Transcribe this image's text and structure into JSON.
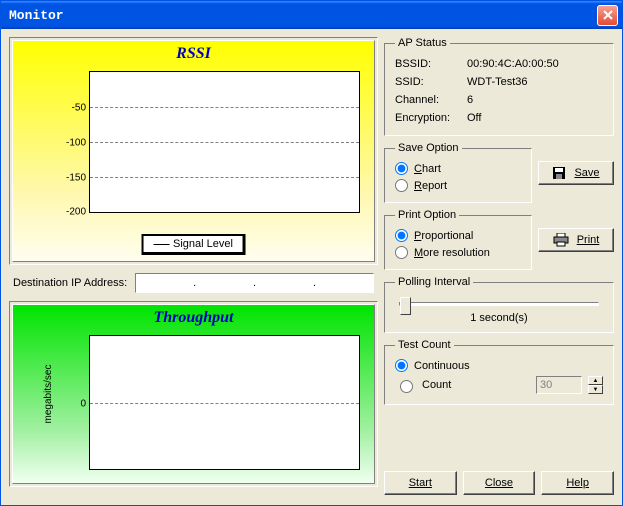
{
  "window": {
    "title": "Monitor"
  },
  "chart_data": [
    {
      "type": "line",
      "title": "RSSI",
      "ylabel": "",
      "ylim": [
        -200,
        0
      ],
      "yticks": [
        -50,
        -100,
        -150,
        -200
      ],
      "series": [
        {
          "name": "Signal Level",
          "values": []
        }
      ],
      "legend_text": "Signal Level"
    },
    {
      "type": "line",
      "title": "Throughput",
      "ylabel": "megabits/sec",
      "yticks": [
        0
      ],
      "series": [
        {
          "name": "Throughput",
          "values": []
        }
      ]
    }
  ],
  "ip": {
    "label": "Destination IP Address:"
  },
  "ap_status": {
    "legend": "AP Status",
    "bssid_label": "BSSID:",
    "bssid": "00:90:4C:A0:00:50",
    "ssid_label": "SSID:",
    "ssid": "WDT-Test36",
    "channel_label": "Channel:",
    "channel": "6",
    "encryption_label": "Encryption:",
    "encryption": "Off"
  },
  "save_option": {
    "legend": "Save Option",
    "chart": "Chart",
    "report": "Report",
    "button": "Save"
  },
  "print_option": {
    "legend": "Print Option",
    "proportional": "Proportional",
    "more": "More resolution",
    "button": "Print"
  },
  "polling": {
    "legend": "Polling Interval",
    "value": "1 second(s)"
  },
  "test_count": {
    "legend": "Test Count",
    "continuous": "Continuous",
    "count": "Count",
    "count_value": "30"
  },
  "buttons": {
    "start": "Start",
    "close": "Close",
    "help": "Help"
  }
}
